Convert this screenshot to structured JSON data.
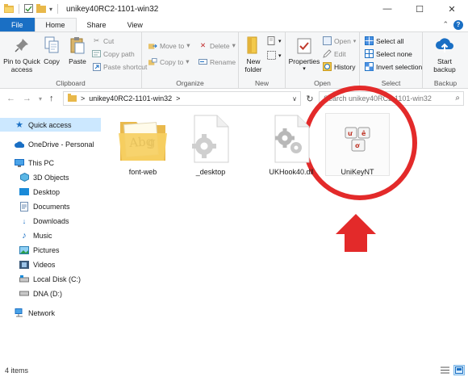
{
  "window": {
    "title": "unikey40RC2-1101-win32",
    "controls": {
      "minimize": "—",
      "maximize": "☐",
      "close": "✕"
    }
  },
  "ribbon_tabs": [
    "File",
    "Home",
    "Share",
    "View"
  ],
  "ribbon": {
    "clipboard": {
      "label": "Clipboard",
      "pin": "Pin to Quick access",
      "copy": "Copy",
      "paste": "Paste",
      "cut": "Cut",
      "copy_path": "Copy path",
      "paste_shortcut": "Paste shortcut"
    },
    "organize": {
      "label": "Organize",
      "move_to": "Move to",
      "copy_to": "Copy to",
      "delete": "Delete",
      "rename": "Rename"
    },
    "new": {
      "label": "New",
      "new_folder": "New folder"
    },
    "open": {
      "label": "Open",
      "properties": "Properties",
      "open": "Open",
      "edit": "Edit",
      "history": "History"
    },
    "select": {
      "label": "Select",
      "select_all": "Select all",
      "select_none": "Select none",
      "invert_selection": "Invert selection"
    },
    "backup": {
      "label": "Backup",
      "start_backup": "Start backup"
    }
  },
  "address": {
    "path": "unikey40RC2-1101-win32",
    "separator": ">",
    "search_placeholder": "Search unikey40RC2-1101-win32"
  },
  "nav_pane": {
    "quick_access": "Quick access",
    "onedrive": "OneDrive - Personal",
    "this_pc": "This PC",
    "items": [
      "3D Objects",
      "Desktop",
      "Documents",
      "Downloads",
      "Music",
      "Pictures",
      "Videos",
      "Local Disk (C:)",
      "DNA (D:)"
    ],
    "network": "Network"
  },
  "files": [
    {
      "name": "font-web",
      "type": "folder"
    },
    {
      "name": "_desktop",
      "type": "settings-file"
    },
    {
      "name": "UKHook40.dll",
      "type": "dll"
    },
    {
      "name": "UniKeyNT",
      "type": "exe"
    }
  ],
  "status": {
    "item_count": "4 items"
  },
  "colors": {
    "accent": "#1a6fc4",
    "annotation_red": "#e32a2a",
    "selection": "#cce8ff"
  }
}
